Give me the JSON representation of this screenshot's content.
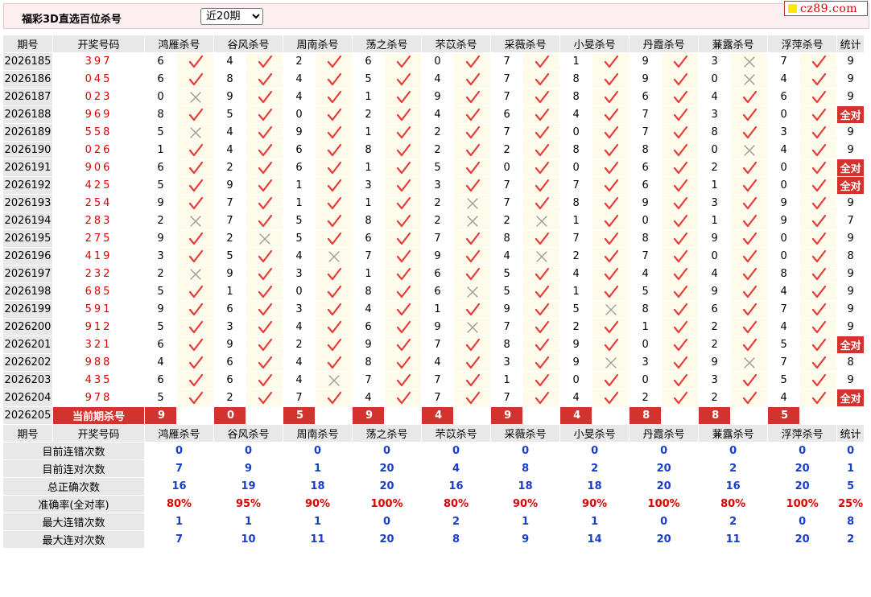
{
  "header": {
    "title": "福彩3D直选百位杀号",
    "select_value": "近20期",
    "logo_text": "cz89.com"
  },
  "columns": [
    "期号",
    "开奖号码",
    "鸿雁杀号",
    "谷风杀号",
    "周南杀号",
    "荡之杀号",
    "芣苡杀号",
    "采薇杀号",
    "小旻杀号",
    "丹霞杀号",
    "蒹露杀号",
    "浮萍杀号",
    "统计"
  ],
  "rows": [
    {
      "period": "2026185",
      "win": "397",
      "kills": [
        [
          6,
          true
        ],
        [
          4,
          true
        ],
        [
          2,
          true
        ],
        [
          6,
          true
        ],
        [
          0,
          true
        ],
        [
          7,
          true
        ],
        [
          1,
          true
        ],
        [
          9,
          true
        ],
        [
          3,
          false
        ],
        [
          7,
          true
        ]
      ],
      "stat": "9"
    },
    {
      "period": "2026186",
      "win": "045",
      "kills": [
        [
          6,
          true
        ],
        [
          8,
          true
        ],
        [
          4,
          true
        ],
        [
          5,
          true
        ],
        [
          4,
          true
        ],
        [
          7,
          true
        ],
        [
          8,
          true
        ],
        [
          9,
          true
        ],
        [
          0,
          false
        ],
        [
          4,
          true
        ]
      ],
      "stat": "9"
    },
    {
      "period": "2026187",
      "win": "023",
      "kills": [
        [
          0,
          false
        ],
        [
          9,
          true
        ],
        [
          4,
          true
        ],
        [
          1,
          true
        ],
        [
          9,
          true
        ],
        [
          7,
          true
        ],
        [
          8,
          true
        ],
        [
          6,
          true
        ],
        [
          4,
          true
        ],
        [
          6,
          true
        ]
      ],
      "stat": "9"
    },
    {
      "period": "2026188",
      "win": "969",
      "kills": [
        [
          8,
          true
        ],
        [
          5,
          true
        ],
        [
          0,
          true
        ],
        [
          2,
          true
        ],
        [
          4,
          true
        ],
        [
          6,
          true
        ],
        [
          4,
          true
        ],
        [
          7,
          true
        ],
        [
          3,
          true
        ],
        [
          0,
          true
        ]
      ],
      "stat": "全对"
    },
    {
      "period": "2026189",
      "win": "558",
      "kills": [
        [
          5,
          false
        ],
        [
          4,
          true
        ],
        [
          9,
          true
        ],
        [
          1,
          true
        ],
        [
          2,
          true
        ],
        [
          7,
          true
        ],
        [
          0,
          true
        ],
        [
          7,
          true
        ],
        [
          8,
          true
        ],
        [
          3,
          true
        ]
      ],
      "stat": "9"
    },
    {
      "period": "2026190",
      "win": "026",
      "kills": [
        [
          1,
          true
        ],
        [
          4,
          true
        ],
        [
          6,
          true
        ],
        [
          8,
          true
        ],
        [
          2,
          true
        ],
        [
          2,
          true
        ],
        [
          8,
          true
        ],
        [
          8,
          true
        ],
        [
          0,
          false
        ],
        [
          4,
          true
        ]
      ],
      "stat": "9"
    },
    {
      "period": "2026191",
      "win": "906",
      "kills": [
        [
          6,
          true
        ],
        [
          2,
          true
        ],
        [
          6,
          true
        ],
        [
          1,
          true
        ],
        [
          5,
          true
        ],
        [
          0,
          true
        ],
        [
          0,
          true
        ],
        [
          6,
          true
        ],
        [
          2,
          true
        ],
        [
          0,
          true
        ]
      ],
      "stat": "全对"
    },
    {
      "period": "2026192",
      "win": "425",
      "kills": [
        [
          5,
          true
        ],
        [
          9,
          true
        ],
        [
          1,
          true
        ],
        [
          3,
          true
        ],
        [
          3,
          true
        ],
        [
          7,
          true
        ],
        [
          7,
          true
        ],
        [
          6,
          true
        ],
        [
          1,
          true
        ],
        [
          0,
          true
        ]
      ],
      "stat": "全对"
    },
    {
      "period": "2026193",
      "win": "254",
      "kills": [
        [
          9,
          true
        ],
        [
          7,
          true
        ],
        [
          1,
          true
        ],
        [
          1,
          true
        ],
        [
          2,
          false
        ],
        [
          7,
          true
        ],
        [
          8,
          true
        ],
        [
          9,
          true
        ],
        [
          3,
          true
        ],
        [
          9,
          true
        ]
      ],
      "stat": "9"
    },
    {
      "period": "2026194",
      "win": "283",
      "kills": [
        [
          2,
          false
        ],
        [
          7,
          true
        ],
        [
          5,
          true
        ],
        [
          8,
          true
        ],
        [
          2,
          false
        ],
        [
          2,
          false
        ],
        [
          1,
          true
        ],
        [
          0,
          true
        ],
        [
          1,
          true
        ],
        [
          9,
          true
        ]
      ],
      "stat": "7"
    },
    {
      "period": "2026195",
      "win": "275",
      "kills": [
        [
          9,
          true
        ],
        [
          2,
          false
        ],
        [
          5,
          true
        ],
        [
          6,
          true
        ],
        [
          7,
          true
        ],
        [
          8,
          true
        ],
        [
          7,
          true
        ],
        [
          8,
          true
        ],
        [
          9,
          true
        ],
        [
          0,
          true
        ]
      ],
      "stat": "9"
    },
    {
      "period": "2026196",
      "win": "419",
      "kills": [
        [
          3,
          true
        ],
        [
          5,
          true
        ],
        [
          4,
          false
        ],
        [
          7,
          true
        ],
        [
          9,
          true
        ],
        [
          4,
          false
        ],
        [
          2,
          true
        ],
        [
          7,
          true
        ],
        [
          0,
          true
        ],
        [
          0,
          true
        ]
      ],
      "stat": "8"
    },
    {
      "period": "2026197",
      "win": "232",
      "kills": [
        [
          2,
          false
        ],
        [
          9,
          true
        ],
        [
          3,
          true
        ],
        [
          1,
          true
        ],
        [
          6,
          true
        ],
        [
          5,
          true
        ],
        [
          4,
          true
        ],
        [
          4,
          true
        ],
        [
          4,
          true
        ],
        [
          8,
          true
        ]
      ],
      "stat": "9"
    },
    {
      "period": "2026198",
      "win": "685",
      "kills": [
        [
          5,
          true
        ],
        [
          1,
          true
        ],
        [
          0,
          true
        ],
        [
          8,
          true
        ],
        [
          6,
          false
        ],
        [
          5,
          true
        ],
        [
          1,
          true
        ],
        [
          5,
          true
        ],
        [
          9,
          true
        ],
        [
          4,
          true
        ]
      ],
      "stat": "9"
    },
    {
      "period": "2026199",
      "win": "591",
      "kills": [
        [
          9,
          true
        ],
        [
          6,
          true
        ],
        [
          3,
          true
        ],
        [
          4,
          true
        ],
        [
          1,
          true
        ],
        [
          9,
          true
        ],
        [
          5,
          false
        ],
        [
          8,
          true
        ],
        [
          6,
          true
        ],
        [
          7,
          true
        ]
      ],
      "stat": "9"
    },
    {
      "period": "2026200",
      "win": "912",
      "kills": [
        [
          5,
          true
        ],
        [
          3,
          true
        ],
        [
          4,
          true
        ],
        [
          6,
          true
        ],
        [
          9,
          false
        ],
        [
          7,
          true
        ],
        [
          2,
          true
        ],
        [
          1,
          true
        ],
        [
          2,
          true
        ],
        [
          4,
          true
        ]
      ],
      "stat": "9"
    },
    {
      "period": "2026201",
      "win": "321",
      "kills": [
        [
          6,
          true
        ],
        [
          9,
          true
        ],
        [
          2,
          true
        ],
        [
          9,
          true
        ],
        [
          7,
          true
        ],
        [
          8,
          true
        ],
        [
          9,
          true
        ],
        [
          0,
          true
        ],
        [
          2,
          true
        ],
        [
          5,
          true
        ]
      ],
      "stat": "全对"
    },
    {
      "period": "2026202",
      "win": "988",
      "kills": [
        [
          4,
          true
        ],
        [
          6,
          true
        ],
        [
          4,
          true
        ],
        [
          8,
          true
        ],
        [
          4,
          true
        ],
        [
          3,
          true
        ],
        [
          9,
          false
        ],
        [
          3,
          true
        ],
        [
          9,
          false
        ],
        [
          7,
          true
        ]
      ],
      "stat": "8"
    },
    {
      "period": "2026203",
      "win": "435",
      "kills": [
        [
          6,
          true
        ],
        [
          6,
          true
        ],
        [
          4,
          false
        ],
        [
          7,
          true
        ],
        [
          7,
          true
        ],
        [
          1,
          true
        ],
        [
          0,
          true
        ],
        [
          0,
          true
        ],
        [
          3,
          true
        ],
        [
          5,
          true
        ]
      ],
      "stat": "9"
    },
    {
      "period": "2026204",
      "win": "978",
      "kills": [
        [
          5,
          true
        ],
        [
          2,
          true
        ],
        [
          7,
          true
        ],
        [
          4,
          true
        ],
        [
          7,
          true
        ],
        [
          7,
          true
        ],
        [
          4,
          true
        ],
        [
          2,
          true
        ],
        [
          2,
          true
        ],
        [
          4,
          true
        ]
      ],
      "stat": "全对"
    }
  ],
  "current": {
    "period": "2026205",
    "label": "当前期杀号",
    "kills": [
      "9",
      "0",
      "5",
      "9",
      "4",
      "9",
      "4",
      "8",
      "8",
      "5"
    ]
  },
  "stats": [
    {
      "label": "目前连错次数",
      "values": [
        "0",
        "0",
        "0",
        "0",
        "0",
        "0",
        "0",
        "0",
        "0",
        "0",
        "0"
      ],
      "red": false
    },
    {
      "label": "目前连对次数",
      "values": [
        "7",
        "9",
        "1",
        "20",
        "4",
        "8",
        "2",
        "20",
        "2",
        "20",
        "1"
      ],
      "red": false
    },
    {
      "label": "总正确次数",
      "values": [
        "16",
        "19",
        "18",
        "20",
        "16",
        "18",
        "18",
        "20",
        "16",
        "20",
        "5"
      ],
      "red": false
    },
    {
      "label": "准确率(全对率)",
      "values": [
        "80%",
        "95%",
        "90%",
        "100%",
        "80%",
        "90%",
        "90%",
        "100%",
        "80%",
        "100%",
        "25%"
      ],
      "red": true
    },
    {
      "label": "最大连错次数",
      "values": [
        "1",
        "1",
        "1",
        "0",
        "2",
        "1",
        "1",
        "0",
        "2",
        "0",
        "8"
      ],
      "red": false
    },
    {
      "label": "最大连对次数",
      "values": [
        "7",
        "10",
        "11",
        "20",
        "8",
        "9",
        "14",
        "20",
        "11",
        "20",
        "2"
      ],
      "red": false
    }
  ],
  "colors": {
    "accent_red": "#d4322c",
    "stat_blue": "#1a3dc9",
    "header_bg": "#e8e8e8",
    "mark_bg": "#fffbea",
    "topbar_bg": "#fdeef0"
  }
}
